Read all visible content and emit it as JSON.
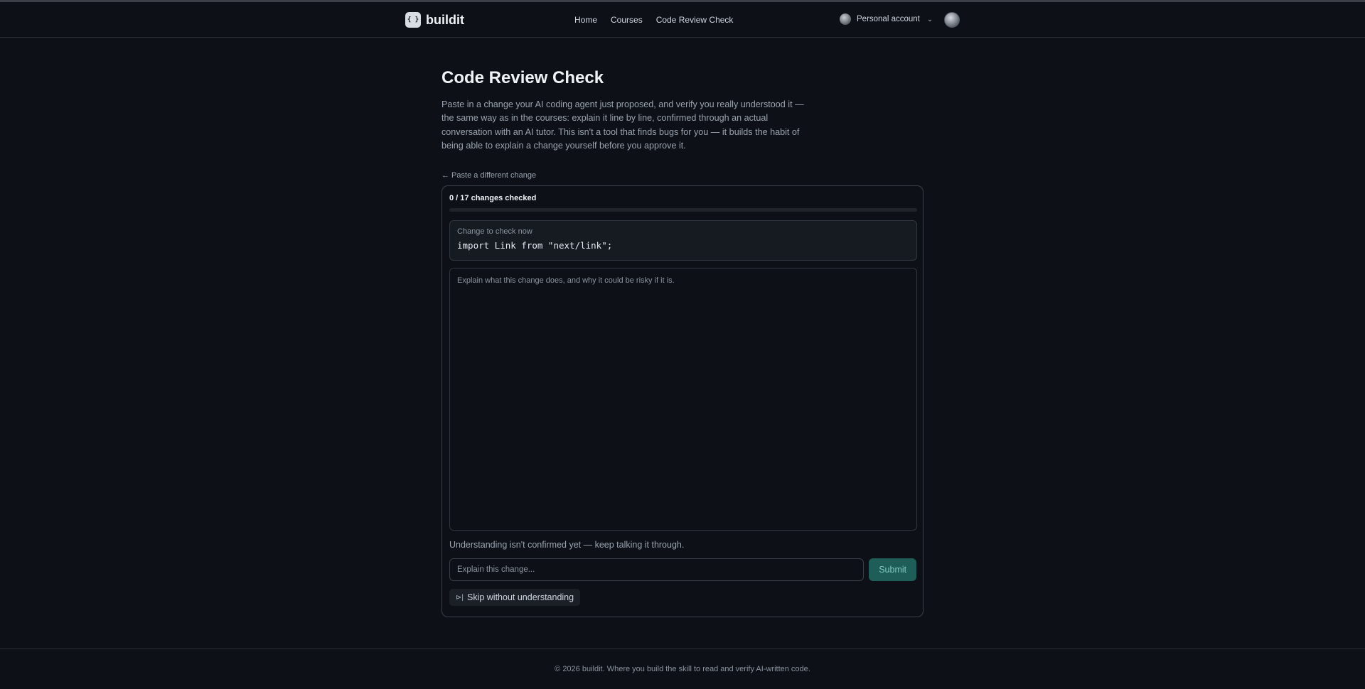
{
  "header": {
    "logo_text": "buildit",
    "logo_glyph": "{ }",
    "nav": [
      "Home",
      "Courses",
      "Code Review Check"
    ],
    "account_label": "Personal account"
  },
  "main": {
    "title": "Code Review Check",
    "intro": "Paste in a change your AI coding agent just proposed, and verify you really understood it — the same way as in the courses: explain it line by line, confirmed through an actual conversation with an AI tutor. This isn't a tool that finds bugs for you — it builds the habit of being able to explain a change yourself before you approve it.",
    "back_link": "← Paste a different change",
    "progress": {
      "label": "0 / 17 changes checked",
      "checked": 0,
      "total": 17
    },
    "change": {
      "label": "Change to check now",
      "code": "import Link from \"next/link\";"
    },
    "chat_hint": "Explain what this change does, and why it could be risky if it is.",
    "status_message": "Understanding isn't confirmed yet — keep talking it through.",
    "answer_placeholder": "Explain this change...",
    "submit_label": "Submit",
    "skip_label": "Skip without understanding"
  },
  "footer": {
    "text": "© 2026 buildit. Where you build the skill to read and verify AI-written code."
  },
  "colors": {
    "background": "#0d1117",
    "accent": "#1f5e58",
    "accent_text": "#7fc9bf"
  }
}
